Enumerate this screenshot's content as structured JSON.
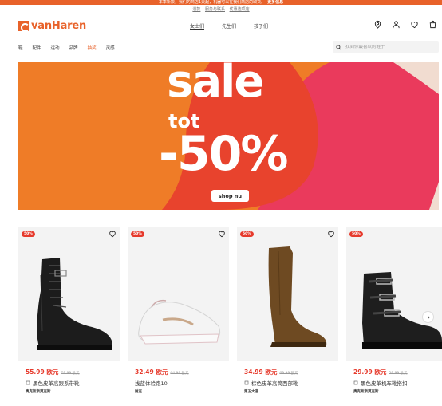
{
  "announcement": {
    "text": "本季新款，我们的商店1天起，机器可以在我们商店的取货。",
    "link": "更多信息"
  },
  "subannouncement": {
    "links": [
      "退款",
      "服务与联系",
      "优惠选项店"
    ]
  },
  "brand": {
    "logo_text": "vanHaren"
  },
  "gender_nav": {
    "items": [
      "女士们",
      "先生们",
      "孩子们"
    ],
    "active": "女士们"
  },
  "header_icons": [
    "location-pin-icon",
    "account-icon",
    "heart-icon",
    "bag-icon"
  ],
  "category_nav": {
    "items": [
      "鞋",
      "配件",
      "运动",
      "品牌",
      "抽奖",
      "灵感"
    ],
    "sale_item": "抽奖"
  },
  "search": {
    "placeholder": "找到你最喜欢的鞋子"
  },
  "banner": {
    "line1": "sale",
    "line2": "tot",
    "line3": "-50%",
    "button": "shop nu",
    "colors": {
      "orange": "#ef7c27",
      "red": "#e8432d",
      "pink": "#ea3a5c",
      "beige": "#f1dcd0"
    }
  },
  "products": [
    {
      "badge": "50%",
      "price": "55.99 欧元",
      "old_price": "79.99 欧元",
      "name": "黑色皮革高跟系带靴",
      "brand": "奥克斯斯莫克斯"
    },
    {
      "badge": "50%",
      "price": "32.49 欧元",
      "old_price": "64.99 欧元",
      "name": "浅蓝体验跑10",
      "brand": "耐克"
    },
    {
      "badge": "50%",
      "price": "34.99 欧元",
      "old_price": "69.99 欧元",
      "name": "棕色皮革高筒西部靴",
      "brand": "第五大道"
    },
    {
      "badge": "50%",
      "price": "29.99 欧元",
      "old_price": "59.99 欧元",
      "name": "黑色皮革机车靴搭扣",
      "brand": "奥克斯斯莫克斯"
    }
  ],
  "accent_color": "#e8622a",
  "sale_red": "#e63a2c"
}
